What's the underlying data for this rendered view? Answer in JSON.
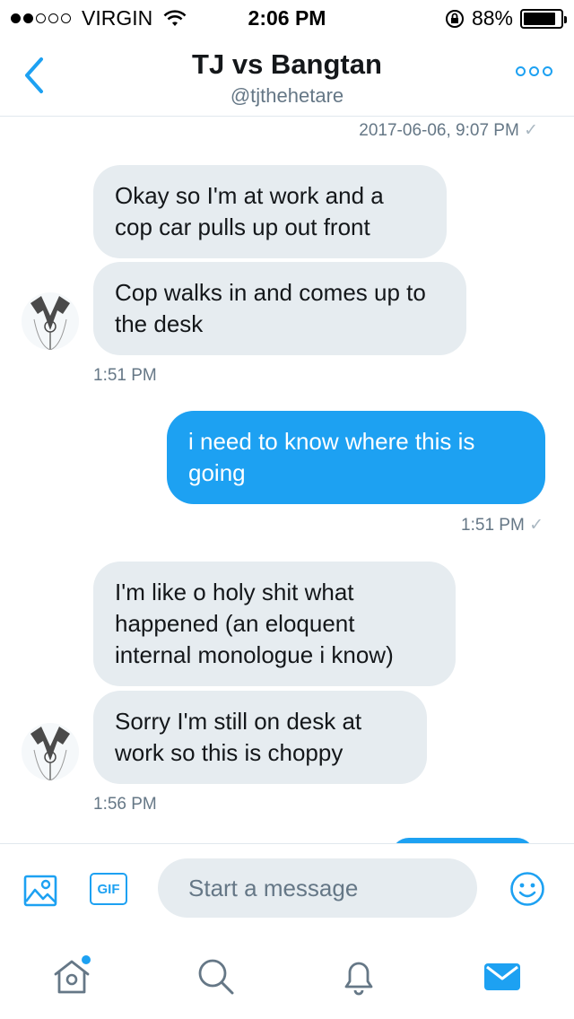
{
  "status_bar": {
    "carrier": "VIRGIN",
    "time": "2:06 PM",
    "battery": "88%",
    "battery_level": 0.88,
    "signal_bars_filled": 2,
    "signal_bars_total": 5
  },
  "header": {
    "title": "TJ vs Bangtan",
    "handle": "@tjthehetare",
    "accent_color": "#1da1f2"
  },
  "conversation": {
    "top_timestamp": "2017-06-06, 9:07 PM",
    "messages": [
      {
        "side": "incoming",
        "text": "Okay so I'm at work and a cop car pulls up out front"
      },
      {
        "side": "incoming",
        "text": "Cop walks in and comes up to the desk"
      },
      {
        "side": "incoming",
        "text": "1:51 PM"
      },
      {
        "side": "outgoing",
        "text": "i need to know where this is going"
      },
      {
        "side": "outgoing",
        "text": "1:51 PM"
      },
      {
        "side": "incoming",
        "text": "I'm like o holy shit what happened (an eloquent internal monologue i know)"
      },
      {
        "side": "incoming",
        "text": "Sorry I'm still on desk at work so this is choppy"
      },
      {
        "side": "incoming",
        "text": "1:56 PM"
      }
    ],
    "incoming_bubble_color": "#e6ecf0",
    "outgoing_bubble_color": "#1da1f2"
  },
  "compose": {
    "placeholder": "Start a message",
    "gif_label": "GIF",
    "media_icon": "image-icon",
    "emoji_icon": "smiley-icon"
  },
  "tabbar": {
    "tabs": [
      {
        "name": "home",
        "icon": "home-icon",
        "active": false,
        "notification_dot": true
      },
      {
        "name": "search",
        "icon": "search-icon",
        "active": false
      },
      {
        "name": "notifications",
        "icon": "bell-icon",
        "active": false
      },
      {
        "name": "messages",
        "icon": "envelope-icon",
        "active": true
      }
    ]
  }
}
